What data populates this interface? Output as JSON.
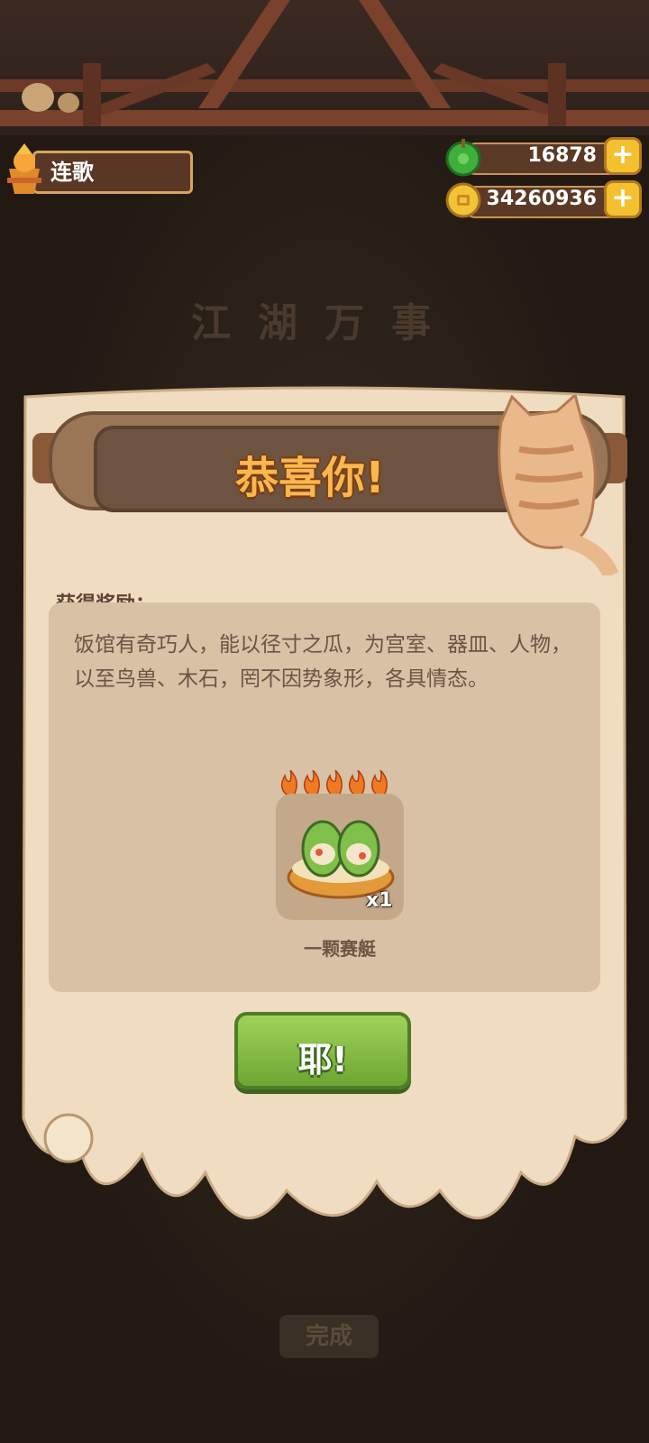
{
  "header": {
    "player_name": "连歌",
    "jade_value": "16878",
    "coin_value": "34260936",
    "plus_symbol": "+"
  },
  "background": {
    "title": "江湖万事",
    "button_label": "完成"
  },
  "dialog": {
    "title": "恭喜你!",
    "reward_label": "获得奖励：",
    "description": "饭馆有奇巧人，能以径寸之瓜，为宫室、器皿、人物，以至鸟兽、木石，罔不因势象形，各具情态。",
    "item": {
      "name": "一颗赛艇",
      "quantity": "x1",
      "flame_count": 5,
      "icon": "stuffed-melon-dish-icon"
    },
    "confirm_label": "耶!"
  },
  "colors": {
    "accent_orange": "#f9b74e",
    "button_green": "#86bf45",
    "paper": "#f0dcc0"
  }
}
